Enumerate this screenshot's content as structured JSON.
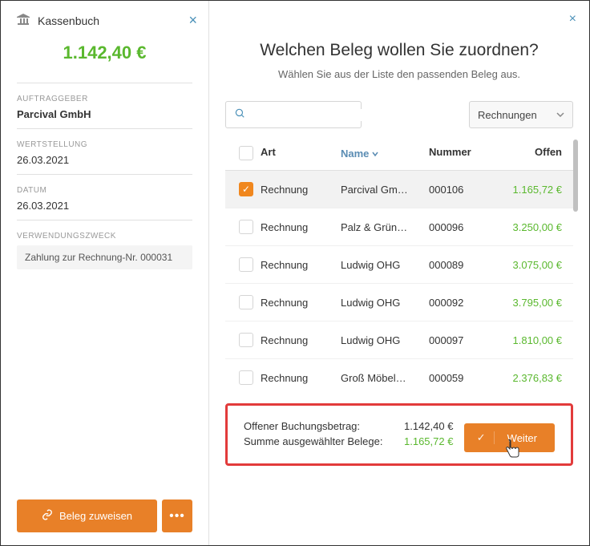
{
  "left": {
    "title": "Kassenbuch",
    "amount": "1.142,40 €",
    "fields": {
      "client_label": "AUFTRAGGEBER",
      "client_value": "Parcival GmbH",
      "wertstellung_label": "WERTSTELLUNG",
      "wertstellung_value": "26.03.2021",
      "datum_label": "DATUM",
      "datum_value": "26.03.2021",
      "purpose_label": "VERWENDUNGSZWECK",
      "purpose_value": "Zahlung zur Rechnung-Nr. 000031"
    },
    "assign_btn": "Beleg zuweisen",
    "more_btn": "•••"
  },
  "right": {
    "heading": "Welchen Beleg wollen Sie zuordnen?",
    "subheading": "Wählen Sie aus der Liste den passenden Beleg aus.",
    "filter_selected": "Rechnungen",
    "headers": {
      "art": "Art",
      "name": "Name",
      "nummer": "Nummer",
      "offen": "Offen"
    },
    "rows": [
      {
        "selected": true,
        "art": "Rechnung",
        "name": "Parcival Gm…",
        "nummer": "000106",
        "offen": "1.165,72 €"
      },
      {
        "selected": false,
        "art": "Rechnung",
        "name": "Palz & Grün…",
        "nummer": "000096",
        "offen": "3.250,00 €"
      },
      {
        "selected": false,
        "art": "Rechnung",
        "name": "Ludwig OHG",
        "nummer": "000089",
        "offen": "3.075,00 €"
      },
      {
        "selected": false,
        "art": "Rechnung",
        "name": "Ludwig OHG",
        "nummer": "000092",
        "offen": "3.795,00 €"
      },
      {
        "selected": false,
        "art": "Rechnung",
        "name": "Ludwig OHG",
        "nummer": "000097",
        "offen": "1.810,00 €"
      },
      {
        "selected": false,
        "art": "Rechnung",
        "name": "Groß Möbel…",
        "nummer": "000059",
        "offen": "2.376,83 €"
      }
    ],
    "summary": {
      "open_label": "Offener Buchungsbetrag:",
      "open_value": "1.142,40 €",
      "sum_label": "Summe ausgewählter Belege:",
      "sum_value": "1.165,72 €"
    },
    "next_btn": "Weiter"
  }
}
